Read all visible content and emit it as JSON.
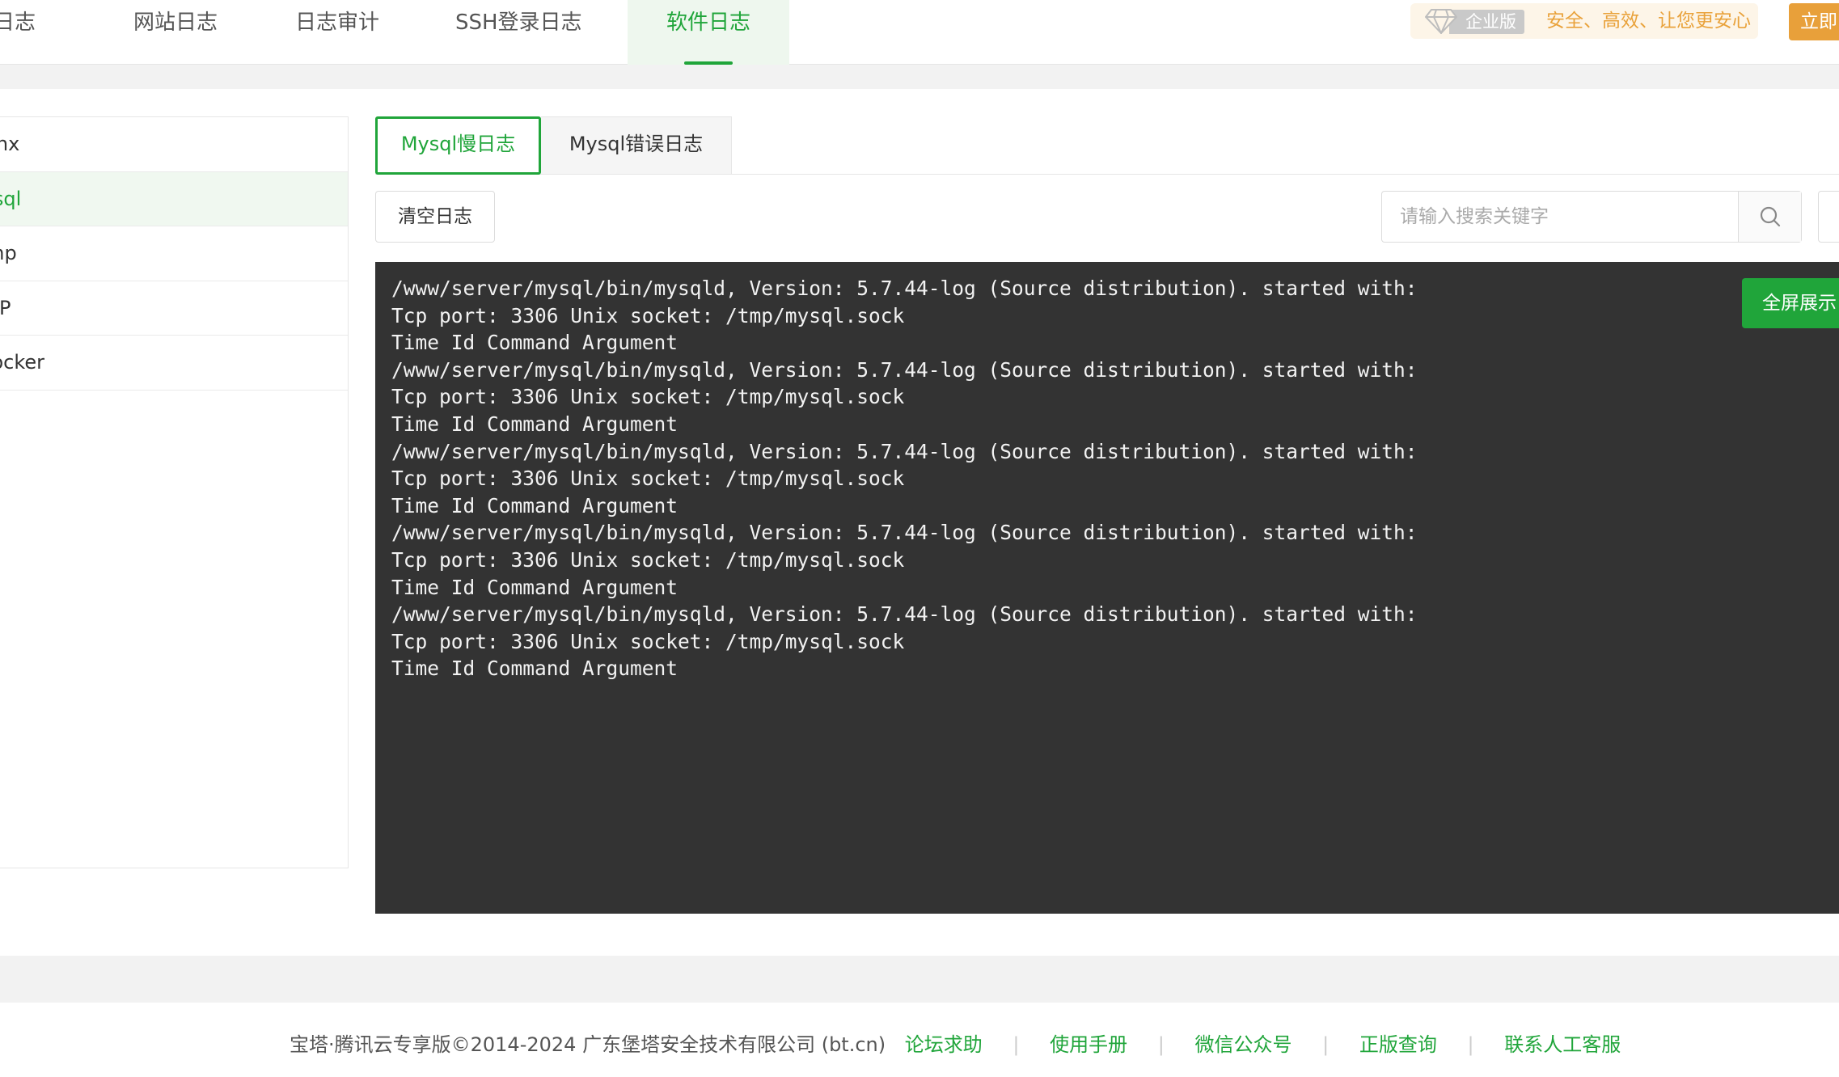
{
  "top_tabs": [
    {
      "label": "面板日志",
      "active": false
    },
    {
      "label": "网站日志",
      "active": false
    },
    {
      "label": "日志审计",
      "active": false
    },
    {
      "label": "SSH登录日志",
      "active": false
    },
    {
      "label": "软件日志",
      "active": true
    }
  ],
  "promo": {
    "badge": "企业版",
    "text": "安全、高效、让您更安心",
    "button": "立即"
  },
  "sidebar": {
    "items": [
      {
        "label": "Nginx",
        "active": false
      },
      {
        "label": "Mysql",
        "active": true
      },
      {
        "label": "php",
        "active": false
      },
      {
        "label": "FTP",
        "active": false
      },
      {
        "label": "Docker",
        "active": false
      }
    ]
  },
  "sub_tabs": [
    {
      "label": "Mysql慢日志",
      "active": true
    },
    {
      "label": "Mysql错误日志",
      "active": false
    }
  ],
  "toolbar": {
    "clear_label": "清空日志",
    "search_placeholder": "请输入搜索关键字",
    "search_value": ""
  },
  "console": {
    "lines": [
      "/www/server/mysql/bin/mysqld, Version: 5.7.44-log (Source distribution). started with:",
      "Tcp port: 3306 Unix socket: /tmp/mysql.sock",
      "Time Id Command Argument",
      "/www/server/mysql/bin/mysqld, Version: 5.7.44-log (Source distribution). started with:",
      "Tcp port: 3306 Unix socket: /tmp/mysql.sock",
      "Time Id Command Argument",
      "/www/server/mysql/bin/mysqld, Version: 5.7.44-log (Source distribution). started with:",
      "Tcp port: 3306 Unix socket: /tmp/mysql.sock",
      "Time Id Command Argument",
      "/www/server/mysql/bin/mysqld, Version: 5.7.44-log (Source distribution). started with:",
      "Tcp port: 3306 Unix socket: /tmp/mysql.sock",
      "Time Id Command Argument",
      "/www/server/mysql/bin/mysqld, Version: 5.7.44-log (Source distribution). started with:",
      "Tcp port: 3306 Unix socket: /tmp/mysql.sock",
      "Time Id Command Argument"
    ],
    "fullscreen_label": "全屏展示"
  },
  "footer": {
    "copyright": "宝塔·腾讯云专享版©2014-2024 广东堡塔安全技术有限公司 (bt.cn)",
    "links": [
      "论坛求助",
      "使用手册",
      "微信公众号",
      "正版查询",
      "联系人工客服"
    ]
  },
  "colors": {
    "accent": "#20a53a",
    "promo": "#e9a23b",
    "console_bg": "#333333"
  },
  "icons": {
    "promo": "diamond-icon",
    "search": "search-icon"
  }
}
